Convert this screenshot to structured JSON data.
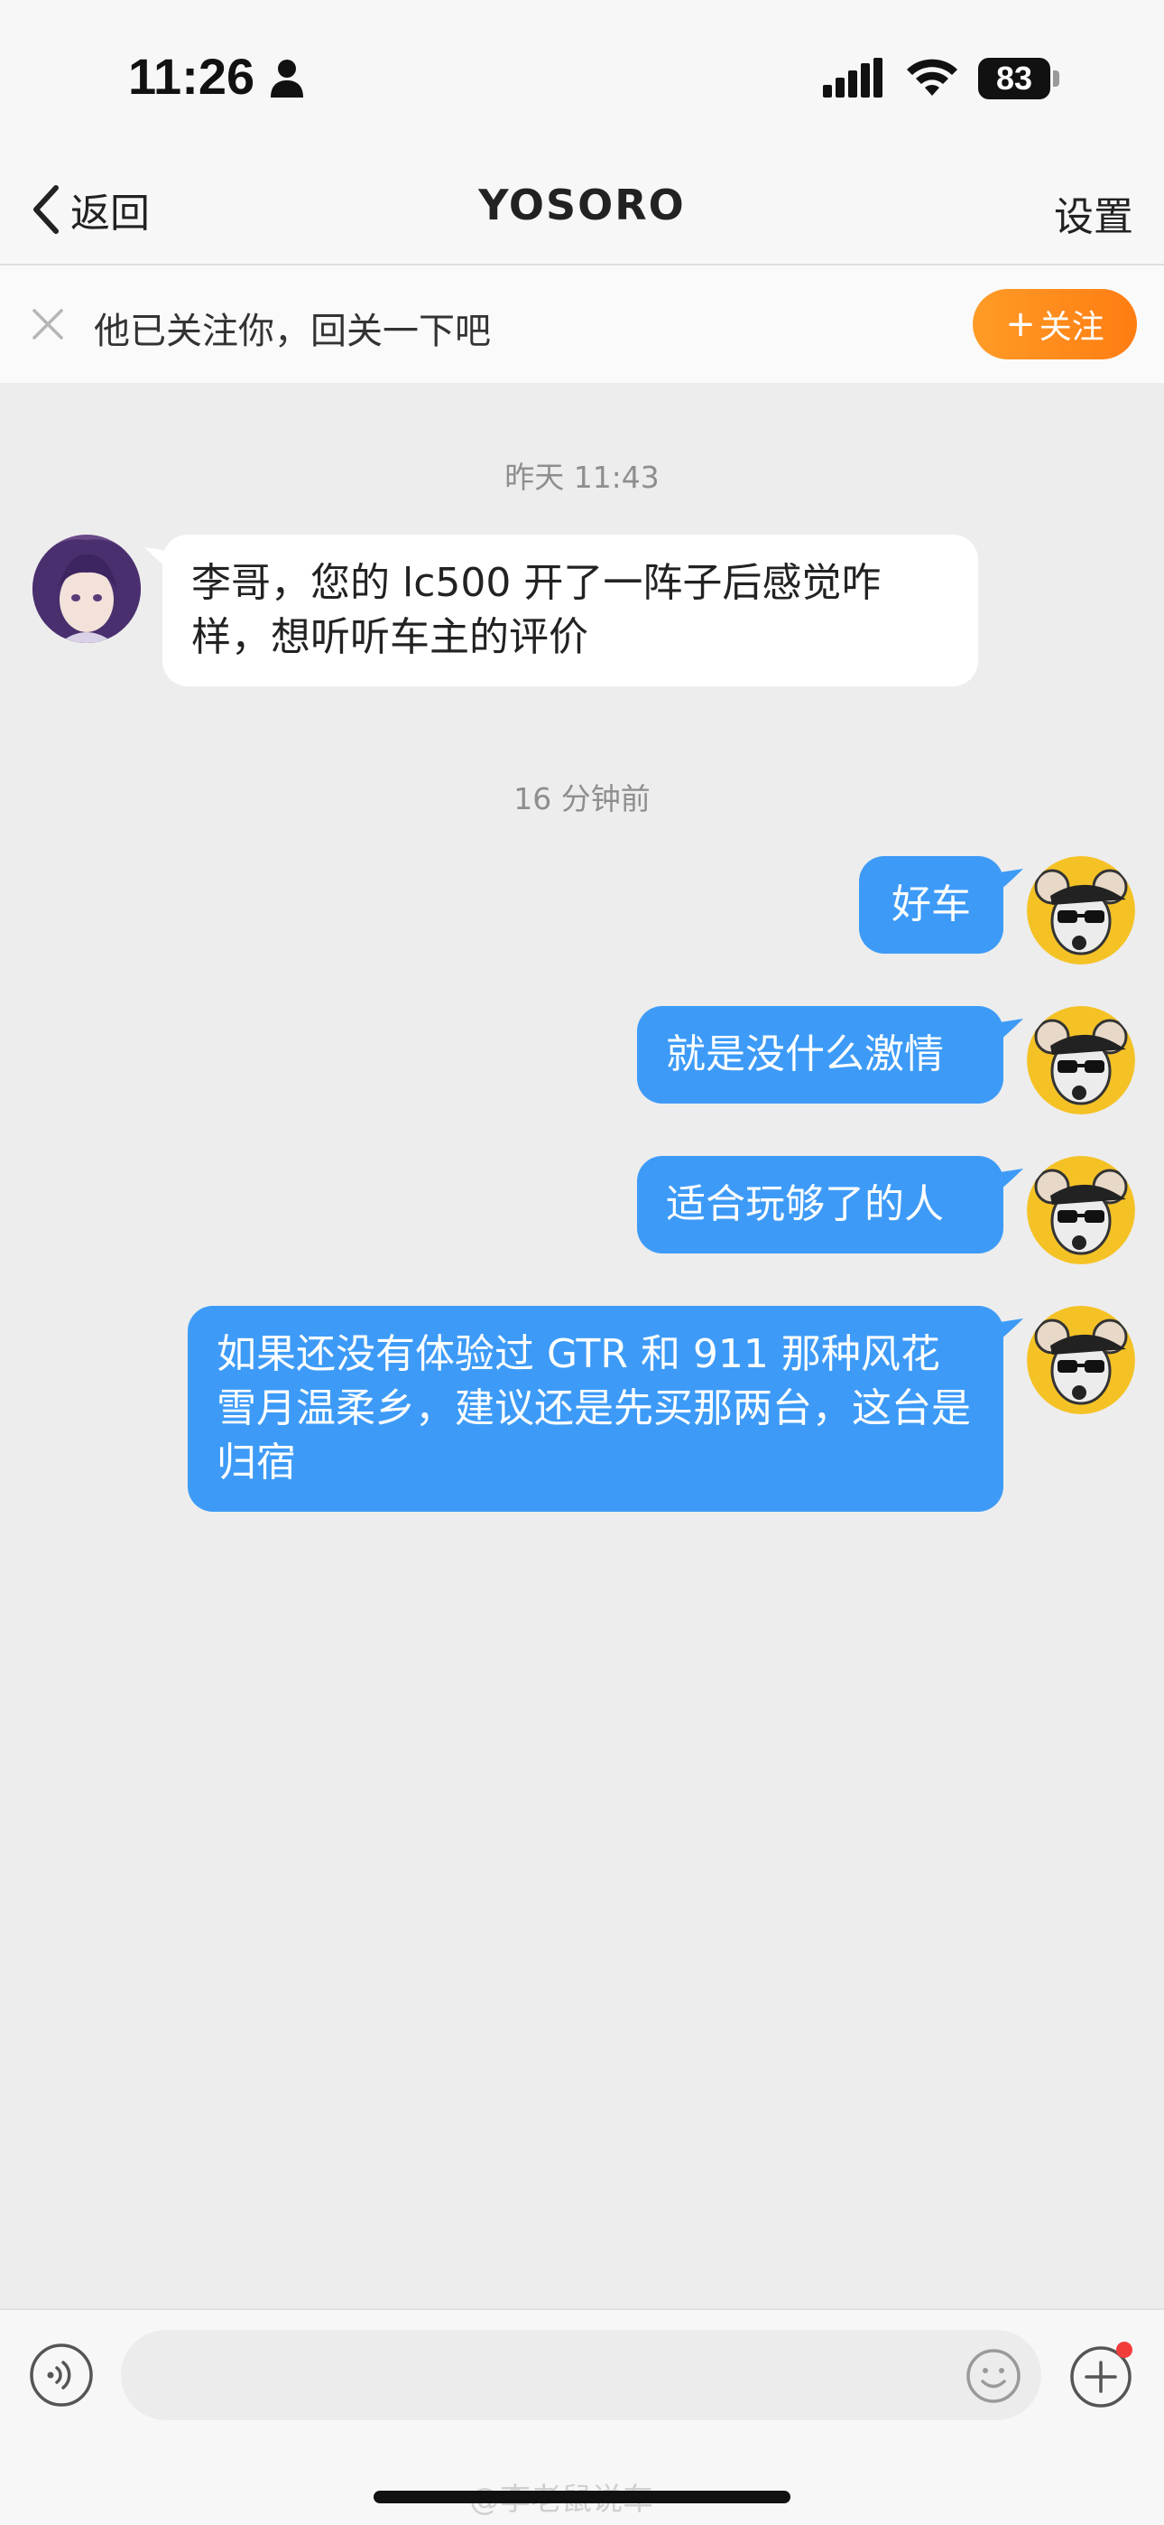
{
  "status_bar": {
    "time": "11:26",
    "battery": "83"
  },
  "nav": {
    "back_label": "返回",
    "title": "YOSORO",
    "settings_label": "设置"
  },
  "follow_banner": {
    "text": "他已关注你，回关一下吧",
    "button_plus": "+",
    "button_label": "关注",
    "accent_color": "#ff8a1c"
  },
  "messages": {
    "group1_time": "昨天 11:43",
    "incoming_1": "李哥，您的 lc500 开了一阵子后感觉咋样，想听听车主的评价",
    "group2_time": "16 分钟前",
    "outgoing_1": "好车",
    "outgoing_2": "就是没什么激情",
    "outgoing_3": "适合玩够了的人",
    "outgoing_4": "如果还没有体验过 GTR 和 911 那种风花雪月温柔乡，建议还是先买那两台，这台是归宿",
    "outgoing_color": "#3d9bf7"
  },
  "input": {
    "placeholder": ""
  },
  "watermark": "@李老鼠说车"
}
